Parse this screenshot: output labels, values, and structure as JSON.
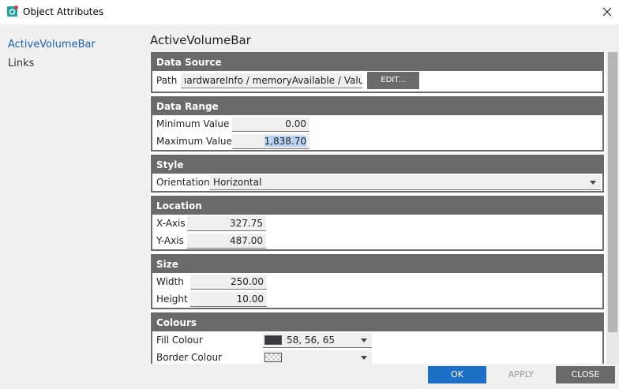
{
  "window": {
    "title": "Object Attributes",
    "icon": "app-icon",
    "close_icon": "close-icon"
  },
  "sidebar": {
    "items": [
      {
        "label": "ActiveVolumeBar",
        "active": true
      },
      {
        "label": "Links",
        "active": false
      }
    ]
  },
  "main": {
    "title": "ActiveVolumeBar",
    "data_source": {
      "header": "Data Source",
      "path_label": "Path",
      "path_value": "ıardwareInfo / memoryAvailable / Value",
      "edit_label": "EDIT..."
    },
    "data_range": {
      "header": "Data Range",
      "min_label": "Minimum Value",
      "min_value": "0.00",
      "max_label": "Maximum Value",
      "max_value": "1,838.70"
    },
    "style": {
      "header": "Style",
      "orientation_label": "Orientation",
      "orientation_value": "Horizontal"
    },
    "location": {
      "header": "Location",
      "x_label": "X-Axis",
      "x_value": "327.75",
      "y_label": "Y-Axis",
      "y_value": "487.00"
    },
    "size": {
      "header": "Size",
      "width_label": "Width",
      "width_value": "250.00",
      "height_label": "Height",
      "height_value": "10.00"
    },
    "colours": {
      "header": "Colours",
      "fill_label": "Fill Colour",
      "fill_value": "58, 56, 65",
      "fill_color": "#3a3841",
      "border_label": "Border Colour",
      "border_value": ""
    }
  },
  "footer": {
    "ok_label": "OK",
    "apply_label": "APPLY",
    "close_label": "CLOSE"
  },
  "colors": {
    "accent": "#1e6fc8",
    "section_header": "#6a6a6a",
    "active_link": "#1f5fa8"
  }
}
